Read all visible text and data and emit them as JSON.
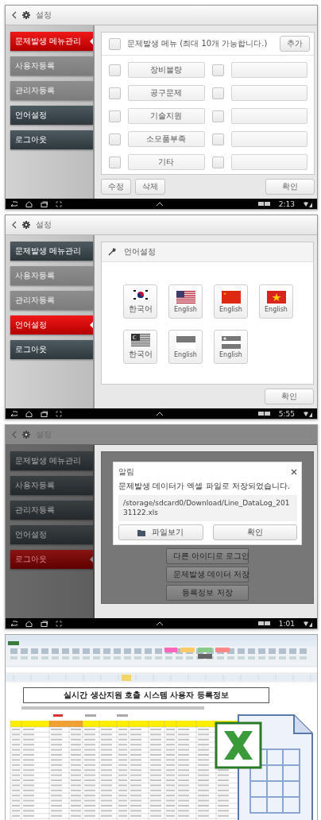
{
  "screens": [
    {
      "kind": "problem-menu",
      "dimmed": false,
      "header": {
        "title": "설정"
      },
      "menu": [
        {
          "label": "문제발생 메뉴관리",
          "selected": true,
          "disabled": false
        },
        {
          "label": "사용자등록",
          "selected": false,
          "disabled": true
        },
        {
          "label": "관리자등록",
          "selected": false,
          "disabled": true
        },
        {
          "label": "언어설정",
          "selected": false,
          "disabled": false
        },
        {
          "label": "로그아웃",
          "selected": false,
          "disabled": false
        }
      ],
      "content": {
        "heading": "문제발생 메뉴 (최대 10개 가능합니다.)",
        "heading_checked": false,
        "add_button": "추가",
        "rows": [
          {
            "checked": false,
            "value": "장비불량",
            "right_checked": false
          },
          {
            "checked": false,
            "value": "공구문제",
            "right_checked": false
          },
          {
            "checked": false,
            "value": "기술지원",
            "right_checked": false
          },
          {
            "checked": false,
            "value": "소모품부족",
            "right_checked": false
          },
          {
            "checked": false,
            "value": "기타",
            "right_checked": false
          }
        ],
        "footer_buttons": [
          "수정",
          "삭제"
        ],
        "confirm_button": "확인"
      },
      "status": {
        "time": "2:13"
      }
    },
    {
      "kind": "language",
      "dimmed": false,
      "header": {
        "title": "설정"
      },
      "menu": [
        {
          "label": "문제발생 메뉴관리",
          "selected": false,
          "disabled": false
        },
        {
          "label": "사용자등록",
          "selected": false,
          "disabled": true
        },
        {
          "label": "관리자등록",
          "selected": false,
          "disabled": true
        },
        {
          "label": "언어설정",
          "selected": true,
          "disabled": false
        },
        {
          "label": "로그아웃",
          "selected": false,
          "disabled": false
        }
      ],
      "content": {
        "heading": "언어설정",
        "languages": [
          {
            "label": "한국어",
            "kind": "kr"
          },
          {
            "label": "English",
            "kind": "us"
          },
          {
            "label": "English",
            "kind": "cn"
          },
          {
            "label": "English",
            "kind": "vn"
          },
          {
            "label": "한국어",
            "kind": "my"
          },
          {
            "label": "English",
            "kind": "id"
          },
          {
            "label": "English",
            "kind": "sg"
          }
        ],
        "confirm_button": "확인"
      },
      "status": {
        "time": "5:55"
      }
    },
    {
      "kind": "logout",
      "dimmed": true,
      "header": {
        "title": "설정"
      },
      "menu": [
        {
          "label": "문제발생 메뉴관리",
          "selected": false
        },
        {
          "label": "사용자등록",
          "selected": false
        },
        {
          "label": "관리자등록",
          "selected": false
        },
        {
          "label": "언어설정",
          "selected": false
        },
        {
          "label": "로그아웃",
          "selected": true
        }
      ],
      "content": {
        "dialog": {
          "title": "알림",
          "message": "문제발생 데이터가 엑셀 파일로 저장되었습니다.",
          "path": "/storage/sdcard0/Download/Line_DataLog_20131122.xls",
          "view_button": "파일보기",
          "ok_button": "확인"
        },
        "buttons": [
          "다른 아이디로 로그인",
          "문제발생 데이터 저장",
          "등록정보 저장"
        ]
      },
      "status": {
        "time": "1:01"
      }
    }
  ],
  "spreadsheet": {
    "title": "실시간 생산지원 호출 시스템 사용자 등록정보"
  }
}
